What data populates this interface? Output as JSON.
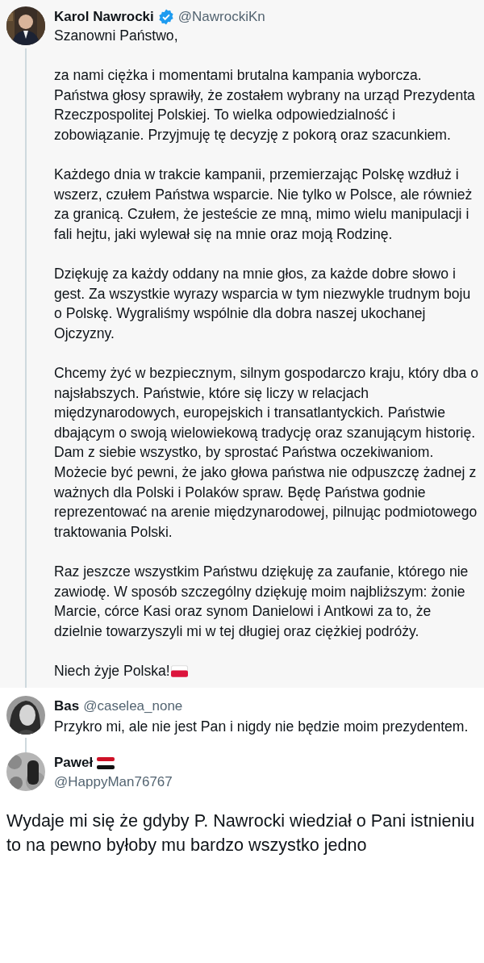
{
  "post": {
    "author": "Karol Nawrocki",
    "verified": true,
    "handle": "@NawrockiKn",
    "paragraphs": [
      "Szanowni Państwo,",
      "za nami ciężka i momentami brutalna kampania wyborcza. Państwa głosy sprawiły, że zostałem wybrany na urząd Prezydenta Rzeczpospolitej Polskiej. To wielka odpowiedzialność i zobowiązanie. Przyjmuję tę decyzję z pokorą oraz szacunkiem.",
      "Każdego dnia w trakcie kampanii, przemierzając Polskę wzdłuż i wszerz, czułem Państwa wsparcie. Nie tylko w Polsce, ale również za granicą. Czułem, że jesteście ze mną, mimo wielu manipulacji i fali hejtu, jaki wylewał się na mnie oraz moją Rodzinę.",
      "Dziękuję za każdy oddany na mnie głos, za każde dobre słowo i gest. Za wszystkie wyrazy wsparcia w tym niezwykle trudnym boju o Polskę. Wygraliśmy wspólnie dla dobra naszej ukochanej Ojczyzny.",
      "Chcemy żyć w bezpiecznym, silnym gospodarczo kraju, który dba o najsłabszych. Państwie, które się liczy w relacjach międzynarodowych, europejskich i transatlantyckich. Państwie dbającym o swoją wielowiekową tradycję oraz szanującym historię. Dam z siebie wszystko, by sprostać Państwa oczekiwaniom. Możecie być pewni, że jako głowa państwa nie odpuszczę żadnej z ważnych dla Polski i Polaków spraw. Będę Państwa godnie reprezentować na arenie międzynarodowej, pilnując podmiotowego traktowania Polski.",
      "Raz jeszcze wszystkim Państwu dziękuję za zaufanie, którego nie zawiodę. W sposób szczególny dziękuję moim najbliższym: żonie Marcie, córce Kasi oraz synom Danielowi i Antkowi za to, że dzielnie towarzyszyli mi w tej długiej oraz ciężkiej podróży.",
      "Niech żyje Polska!"
    ]
  },
  "replies": [
    {
      "author": "Bas",
      "handle": "@caselea_none",
      "text": "Przykro mi, ale nie jest Pan i nigdy nie będzie moim prezydentem."
    },
    {
      "author": "Paweł",
      "handle": "@HappyMan76767"
    }
  ],
  "comment": "Wydaje mi się że gdyby P. Nawrocki wiedział o Pani istnieniu to na pewno byłoby mu bardzo wszystko jedno"
}
